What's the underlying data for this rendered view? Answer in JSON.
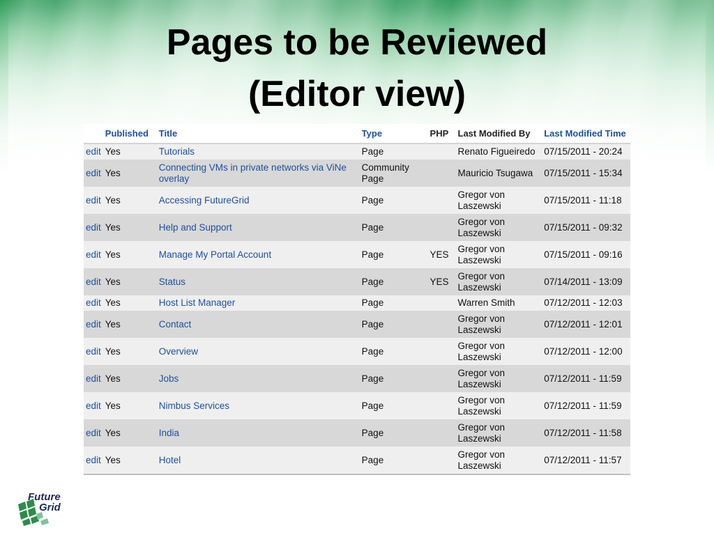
{
  "slide": {
    "title_line1": "Pages to be Reviewed",
    "title_line2": "(Editor view)"
  },
  "table": {
    "headers": {
      "published": "Published",
      "title": "Title",
      "type": "Type",
      "php": "PHP",
      "modified_by": "Last Modified By",
      "modified_time": "Last Modified Time"
    },
    "rows": [
      {
        "edit": "edit",
        "published": "Yes",
        "title": "Tutorials",
        "type": "Page",
        "php": "",
        "modified_by": "Renato Figueiredo",
        "modified_time": "07/15/2011 - 20:24"
      },
      {
        "edit": "edit",
        "published": "Yes",
        "title": "Connecting VMs in private networks via ViNe overlay",
        "type": "Community Page",
        "php": "",
        "modified_by": "Mauricio Tsugawa",
        "modified_time": "07/15/2011 - 15:34"
      },
      {
        "edit": "edit",
        "published": "Yes",
        "title": "Accessing FutureGrid",
        "type": "Page",
        "php": "",
        "modified_by": "Gregor von Laszewski",
        "modified_time": "07/15/2011 - 11:18"
      },
      {
        "edit": "edit",
        "published": "Yes",
        "title": "Help and Support",
        "type": "Page",
        "php": "",
        "modified_by": "Gregor von Laszewski",
        "modified_time": "07/15/2011 - 09:32"
      },
      {
        "edit": "edit",
        "published": "Yes",
        "title": "Manage My Portal Account",
        "type": "Page",
        "php": "YES",
        "modified_by": "Gregor von Laszewski",
        "modified_time": "07/15/2011 - 09:16"
      },
      {
        "edit": "edit",
        "published": "Yes",
        "title": "Status",
        "type": "Page",
        "php": "YES",
        "modified_by": "Gregor von Laszewski",
        "modified_time": "07/14/2011 - 13:09"
      },
      {
        "edit": "edit",
        "published": "Yes",
        "title": "Host List Manager",
        "type": "Page",
        "php": "",
        "modified_by": "Warren Smith",
        "modified_time": "07/12/2011 - 12:03"
      },
      {
        "edit": "edit",
        "published": "Yes",
        "title": "Contact",
        "type": "Page",
        "php": "",
        "modified_by": "Gregor von Laszewski",
        "modified_time": "07/12/2011 - 12:01"
      },
      {
        "edit": "edit",
        "published": "Yes",
        "title": "Overview",
        "type": "Page",
        "php": "",
        "modified_by": "Gregor von Laszewski",
        "modified_time": "07/12/2011 - 12:00"
      },
      {
        "edit": "edit",
        "published": "Yes",
        "title": "Jobs",
        "type": "Page",
        "php": "",
        "modified_by": "Gregor von Laszewski",
        "modified_time": "07/12/2011 - 11:59"
      },
      {
        "edit": "edit",
        "published": "Yes",
        "title": "Nimbus Services",
        "type": "Page",
        "php": "",
        "modified_by": "Gregor von Laszewski",
        "modified_time": "07/12/2011 - 11:59"
      },
      {
        "edit": "edit",
        "published": "Yes",
        "title": "India",
        "type": "Page",
        "php": "",
        "modified_by": "Gregor von Laszewski",
        "modified_time": "07/12/2011 - 11:58"
      },
      {
        "edit": "edit",
        "published": "Yes",
        "title": "Hotel",
        "type": "Page",
        "php": "",
        "modified_by": "Gregor von Laszewski",
        "modified_time": "07/12/2011 - 11:57"
      }
    ]
  },
  "logo": {
    "line1": "Future",
    "line2": "Grid",
    "colors": {
      "mark": "#2e8b4a",
      "text": "#1e2a55"
    }
  },
  "colors": {
    "link": "#1d4f9e",
    "row_odd": "#efefef",
    "row_even": "#d8d8d8",
    "header_green": "#2f9a5a"
  }
}
